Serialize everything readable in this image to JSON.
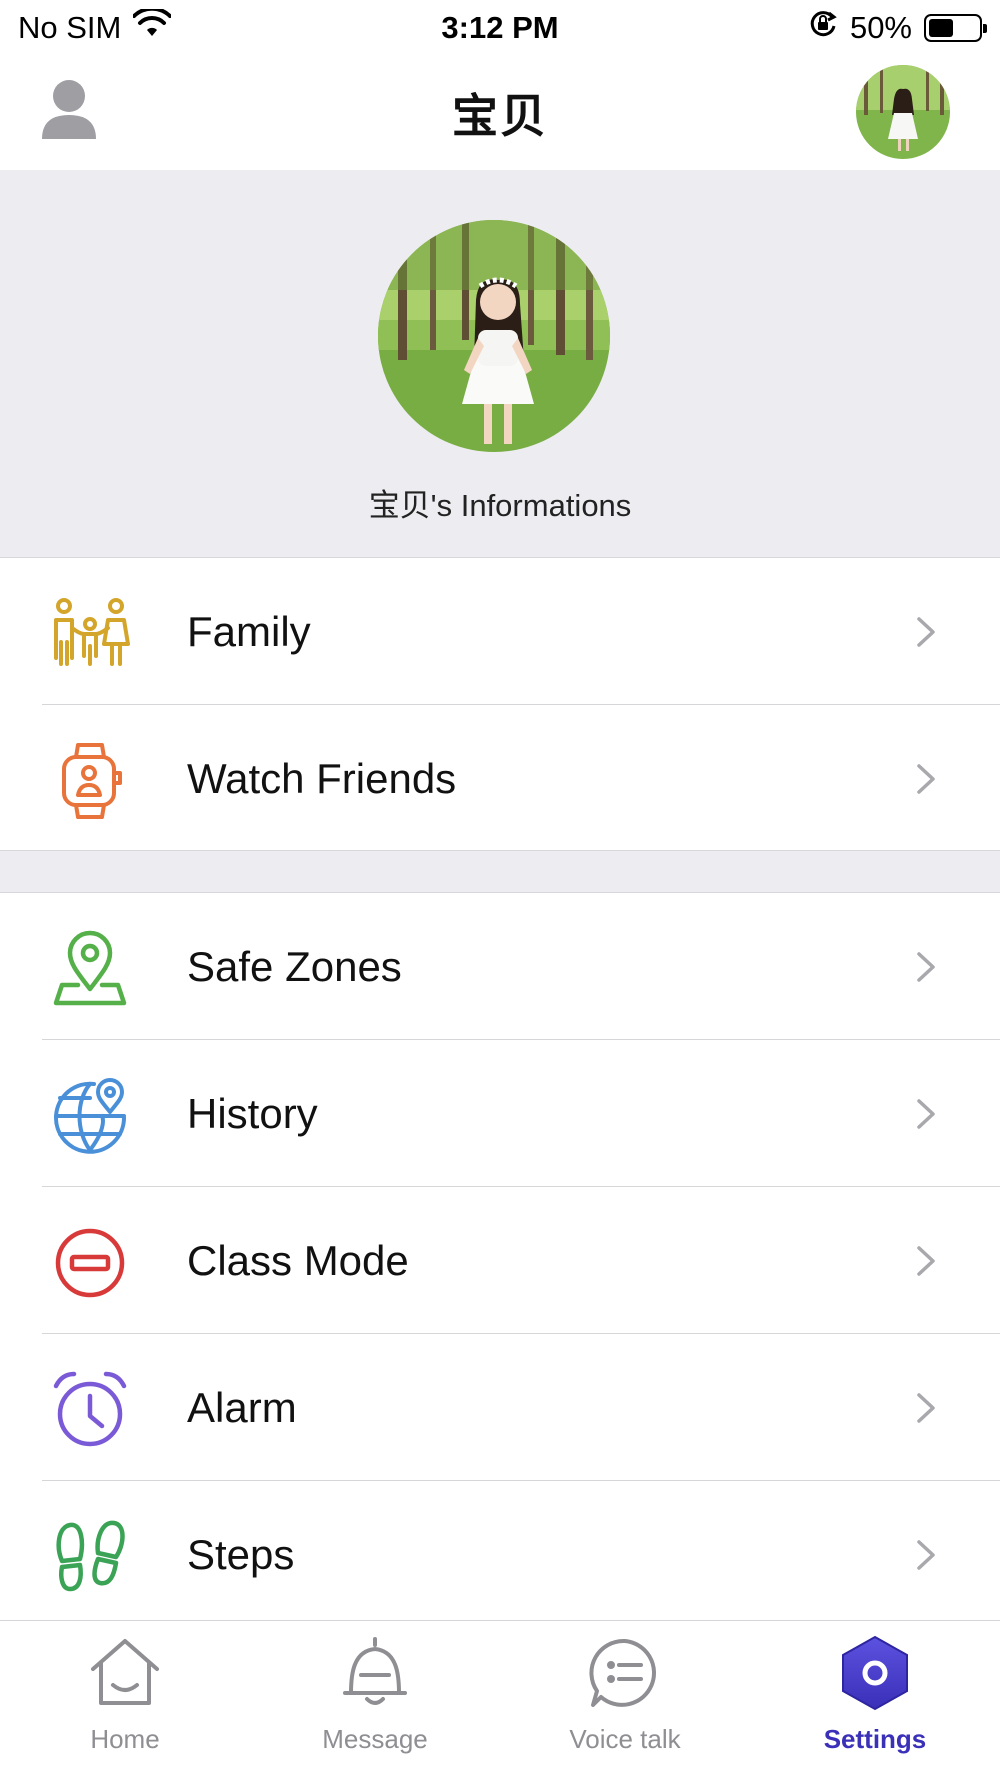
{
  "status_bar": {
    "carrier": "No SIM",
    "time": "3:12 PM",
    "battery_percent": "50%",
    "battery_level": 0.5
  },
  "nav": {
    "title": "宝贝"
  },
  "hero": {
    "caption": "宝贝's Informations"
  },
  "menu_groups": [
    [
      {
        "label": "Family",
        "icon": "family-icon",
        "color": "#d4a52b"
      },
      {
        "label": "Watch Friends",
        "icon": "watch-friends-icon",
        "color": "#e8743b"
      }
    ],
    [
      {
        "label": "Safe Zones",
        "icon": "location-pin-icon",
        "color": "#55b04a"
      },
      {
        "label": "History",
        "icon": "globe-pin-icon",
        "color": "#4a90d9"
      },
      {
        "label": "Class Mode",
        "icon": "no-entry-icon",
        "color": "#d83a3a"
      },
      {
        "label": "Alarm",
        "icon": "alarm-clock-icon",
        "color": "#7a5ad6"
      },
      {
        "label": "Steps",
        "icon": "footprints-icon",
        "color": "#3aa356"
      }
    ]
  ],
  "tab_bar": {
    "tabs": [
      {
        "label": "Home",
        "icon": "home-icon"
      },
      {
        "label": "Message",
        "icon": "bell-icon"
      },
      {
        "label": "Voice talk",
        "icon": "chat-icon"
      },
      {
        "label": "Settings",
        "icon": "settings-icon",
        "active": true
      }
    ],
    "active_color": "#3b30b8",
    "inactive_color": "#8e8e93"
  }
}
